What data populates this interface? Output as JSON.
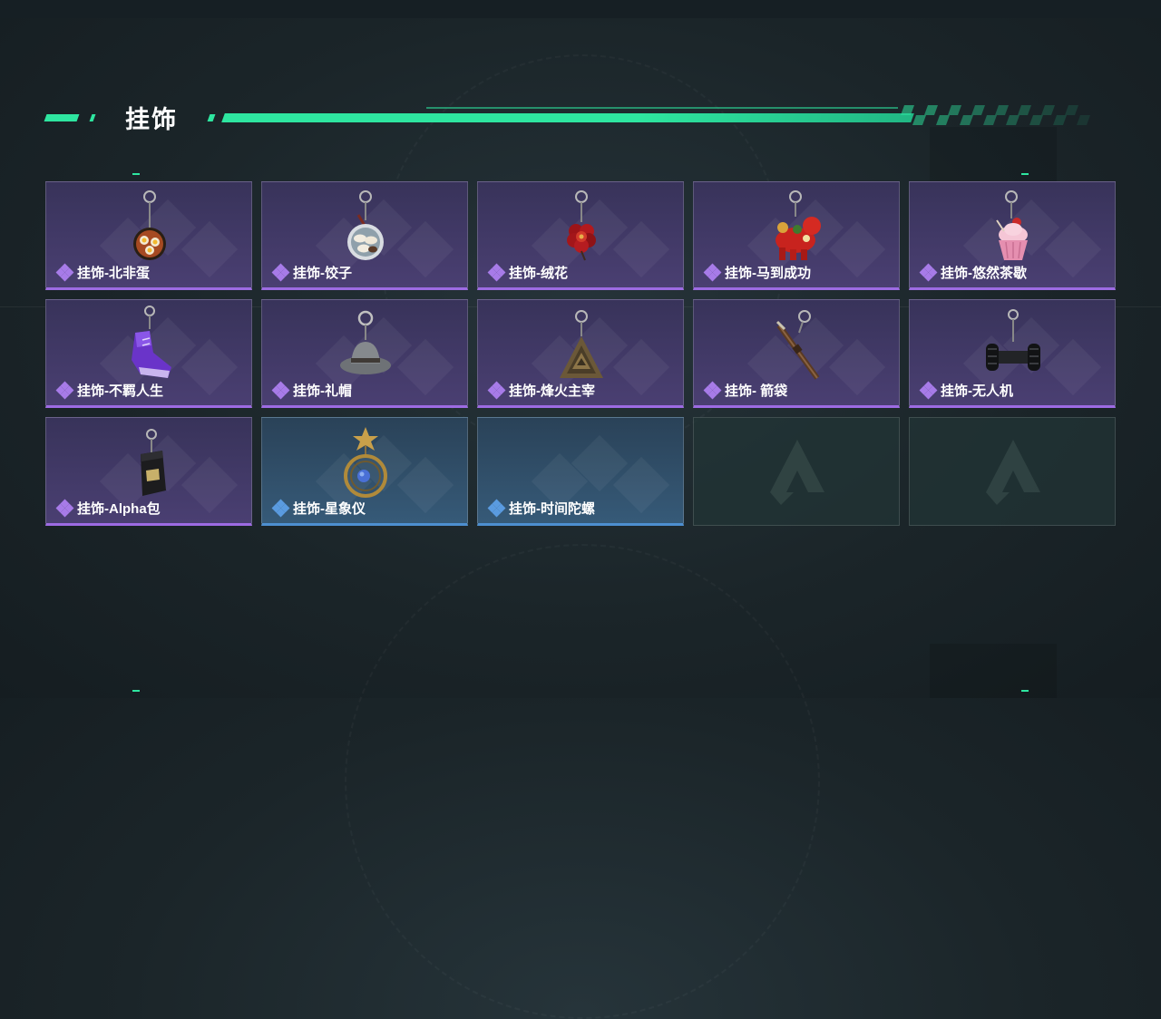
{
  "section": {
    "title": "挂饰"
  },
  "colors": {
    "accent": "#2ee6a0",
    "purple_rarity": "#9d6be3",
    "blue_rarity": "#4d8fd0"
  },
  "items": [
    {
      "name": "挂饰-北非蛋",
      "rarity": "purple",
      "icon": "shakshuka-pan-icon"
    },
    {
      "name": "挂饰-饺子",
      "rarity": "purple",
      "icon": "dumplings-plate-icon"
    },
    {
      "name": "挂饰-绒花",
      "rarity": "purple",
      "icon": "red-velvet-flower-icon"
    },
    {
      "name": "挂饰-马到成功",
      "rarity": "purple",
      "icon": "red-horse-icon"
    },
    {
      "name": "挂饰-悠然茶歇",
      "rarity": "purple",
      "icon": "cupcake-icon"
    },
    {
      "name": "挂饰-不羁人生",
      "rarity": "purple",
      "icon": "purple-sneaker-icon"
    },
    {
      "name": "挂饰-礼帽",
      "rarity": "purple",
      "icon": "fedora-hat-icon"
    },
    {
      "name": "挂饰-烽火主宰",
      "rarity": "purple",
      "icon": "triangle-emblem-icon"
    },
    {
      "name": "挂饰- 箭袋",
      "rarity": "purple",
      "icon": "quiver-icon"
    },
    {
      "name": "挂饰-无人机",
      "rarity": "purple",
      "icon": "drone-wheels-icon"
    },
    {
      "name": "挂饰-Alpha包",
      "rarity": "purple",
      "icon": "black-pouch-icon"
    },
    {
      "name": "挂饰-星象仪",
      "rarity": "blue",
      "icon": "astrolabe-icon"
    },
    {
      "name": "挂饰-时间陀螺",
      "rarity": "blue",
      "icon": ""
    },
    {
      "name": "",
      "rarity": "empty",
      "icon": "placeholder-logo-icon"
    },
    {
      "name": "",
      "rarity": "empty",
      "icon": "placeholder-logo-icon"
    }
  ]
}
